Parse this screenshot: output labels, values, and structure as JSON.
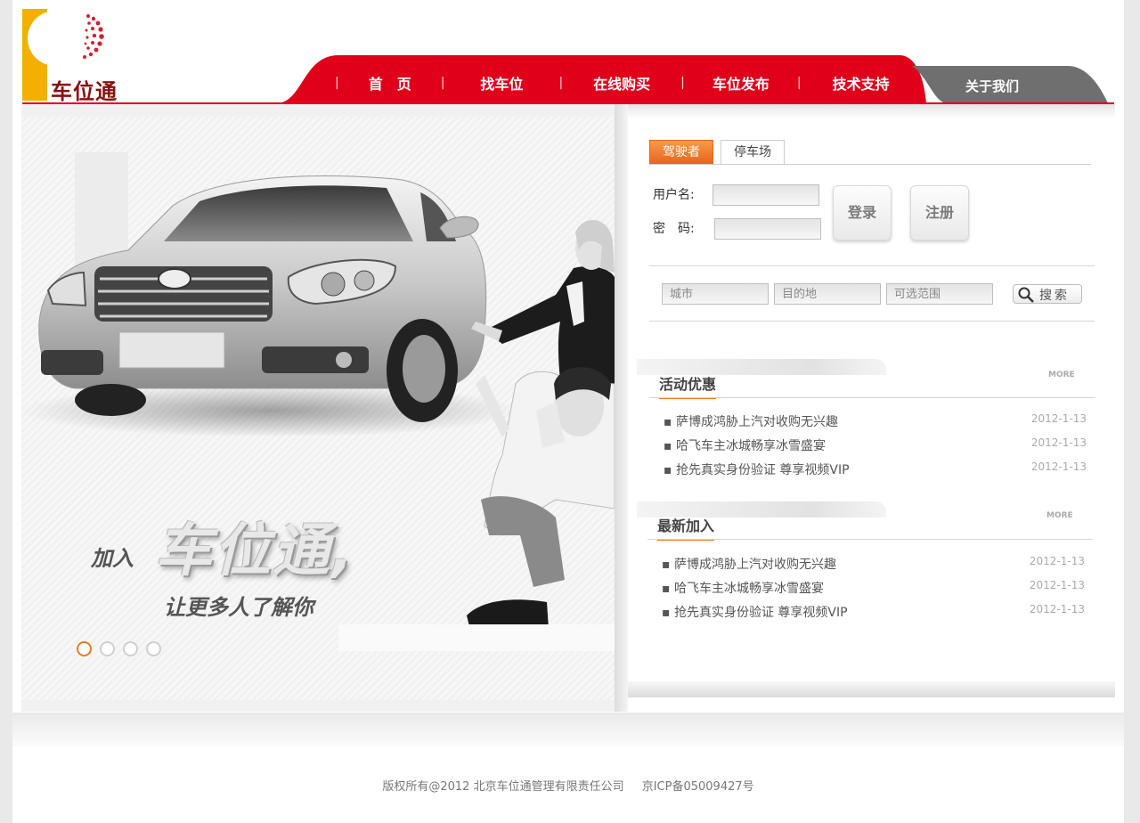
{
  "brand": {
    "name": "车位通"
  },
  "nav": {
    "items": [
      "首　页",
      "找车位",
      "在线购买",
      "车位发布",
      "技术支持"
    ],
    "about": "关于我们"
  },
  "hero": {
    "join": "加入",
    "brand": "车位通,",
    "tagline": "让更多人了解你",
    "slides": 4,
    "active_slide": 1
  },
  "login": {
    "tabs": [
      "驾驶者",
      "停车场"
    ],
    "username_label": "用户名:",
    "password_label": "密　码:",
    "username_value": "",
    "password_value": "",
    "login_button": "登录",
    "register_button": "注册"
  },
  "search": {
    "city_placeholder": "城市",
    "destination_placeholder": "目的地",
    "range_placeholder": "可选范围",
    "button": "搜索"
  },
  "promotions": {
    "title": "活动优惠",
    "more": "MORE",
    "items": [
      {
        "text": "▪ 萨博成鸿胁上汽对收购无兴趣",
        "date": "2012-1-13"
      },
      {
        "text": "▪ 哈飞车主冰城畅享冰雪盛宴",
        "date": "2012-1-13"
      },
      {
        "text": "▪ 抢先真实身份验证 尊享视频VIP",
        "date": "2012-1-13"
      }
    ]
  },
  "latest": {
    "title": "最新加入",
    "more": "MORE",
    "items": [
      {
        "text": "▪ 萨博成鸿胁上汽对收购无兴趣",
        "date": "2012-1-13"
      },
      {
        "text": "▪ 哈飞车主冰城畅享冰雪盛宴",
        "date": "2012-1-13"
      },
      {
        "text": "▪ 抢先真实身份验证 尊享视频VIP",
        "date": "2012-1-13"
      }
    ]
  },
  "footer": {
    "copyright": "版权所有@2012 北京车位通管理有限责任公司",
    "icp": "京ICP备05009427号"
  },
  "colors": {
    "brand_red": "#e0001a",
    "accent_orange": "#f07a20",
    "logo_yellow": "#f3b000"
  }
}
